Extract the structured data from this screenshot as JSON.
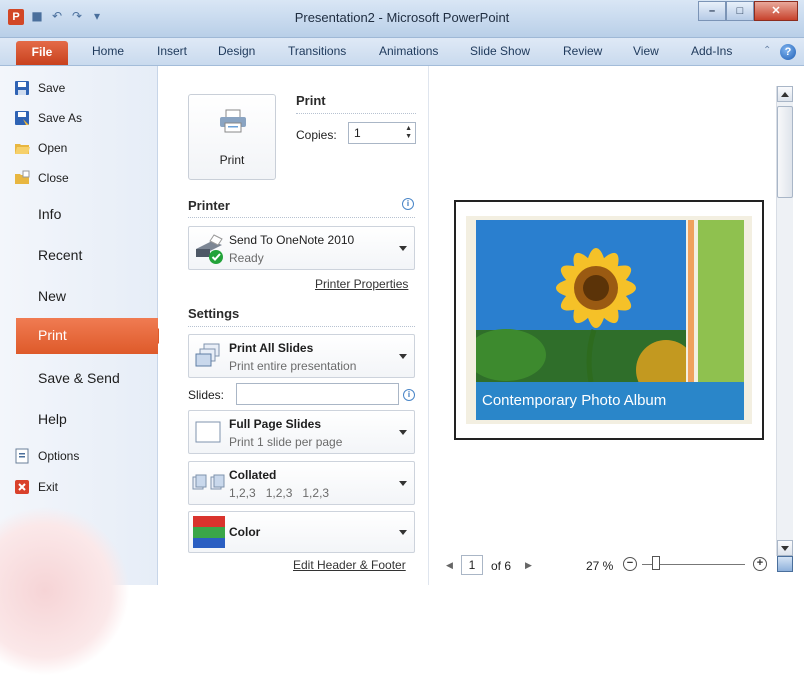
{
  "window": {
    "title": "Presentation2 - Microsoft PowerPoint",
    "app_icon": "P",
    "buttons": {
      "minimize": "–",
      "maximize": "□",
      "close": "✕"
    }
  },
  "ribbon": {
    "tabs": [
      "File",
      "Home",
      "Insert",
      "Design",
      "Transitions",
      "Animations",
      "Slide Show",
      "Review",
      "View",
      "Add-Ins"
    ],
    "help": "?"
  },
  "backstage": {
    "commands": [
      "Save",
      "Save As",
      "Open",
      "Close"
    ],
    "sections": [
      "Info",
      "Recent",
      "New",
      "Print",
      "Save & Send",
      "Help"
    ],
    "bottom": [
      "Options",
      "Exit"
    ],
    "selected": "Print"
  },
  "print": {
    "button_label": "Print",
    "heading": "Print",
    "copies_label": "Copies:",
    "copies_value": "1",
    "printer_heading": "Printer",
    "printer_name": "Send To OneNote 2010",
    "printer_status": "Ready",
    "printer_properties": "Printer Properties",
    "settings_heading": "Settings",
    "range_title": "Print All Slides",
    "range_sub": "Print entire presentation",
    "slides_label": "Slides:",
    "slides_value": "",
    "layout_title": "Full Page Slides",
    "layout_sub": "Print 1 slide per page",
    "collate_title": "Collated",
    "collate_sub": "1,2,3   1,2,3   1,2,3",
    "color_title": "Color",
    "edit_header_footer": "Edit Header & Footer"
  },
  "preview": {
    "slide_caption": "Contemporary Photo Album",
    "page_current": "1",
    "page_of": "of 6",
    "zoom": "27 %"
  }
}
